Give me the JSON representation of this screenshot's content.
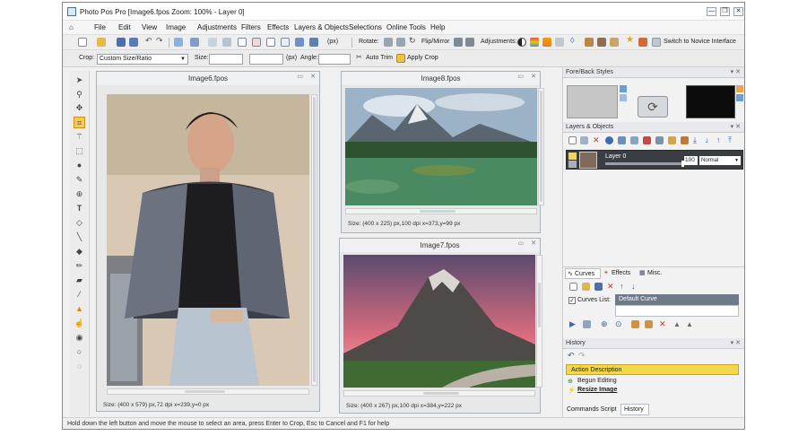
{
  "window": {
    "title": "Photo Pos Pro [Image6.fpos Zoom: 100% - Layer 0]",
    "controls": [
      "—",
      "❐",
      "✕"
    ]
  },
  "menu": [
    "File",
    "Edit",
    "View",
    "Image",
    "Adjustments",
    "Filters",
    "Effects",
    "Layers & Objects",
    "Selections",
    "Online Tools",
    "Help"
  ],
  "toolbar1": {
    "units_label": "(px)",
    "rotate_label": "Rotate:",
    "flip_label": "Flip/Mirror",
    "adjustments_label": "Adjustments:",
    "novice_label": "Switch to Novice Interface"
  },
  "toolbar2": {
    "crop_label": "Crop:",
    "crop_mode": "Custom Size/Ratio",
    "size_label": "Size:",
    "size_width": "",
    "size_height": "",
    "size_units": "(px)",
    "angle_label": "Angle:",
    "angle_value": "",
    "auto_trim_label": "Auto Trim",
    "apply_crop_label": "Apply Crop"
  },
  "documents": [
    {
      "title": "Image6.fpos",
      "status": "Size: (400 x 579) px,72 dpi   x=239,y=0 px"
    },
    {
      "title": "Image8.fpos",
      "status": "Size: (400 x 225) px,100 dpi   x=373,y=99 px"
    },
    {
      "title": "Image7.fpos",
      "status": "Size: (400 x 267) px,100 dpi   x=384,y=222 px"
    }
  ],
  "panels": {
    "fore_back_title": "Fore/Back Styles",
    "layers_title": "Layers & Objects",
    "layer_name": "Layer 0",
    "layer_opacity": "100",
    "layer_blend": "Normal",
    "tabs": [
      "Curves",
      "Effects",
      "Misc."
    ],
    "curves_list_label": "Curves List:",
    "curves_list_value": "Default Curve",
    "history_title": "History",
    "history_items": [
      "Action Description",
      "Begun Editing",
      "Resize Image"
    ],
    "bottom_tabs": [
      "Commands Script",
      "History"
    ]
  },
  "statusbar": "Hold down the left button and move the mouse to select an area, press Enter to Crop, Esc to Cancel and F1 for help",
  "colors": {
    "accent_yellow": "#f5d84a",
    "active_tool": "#f7c85b",
    "window_border": "#a9b1ba",
    "black_swatch": "#0c0c0c",
    "gray_swatch": "#c6c6c6"
  }
}
